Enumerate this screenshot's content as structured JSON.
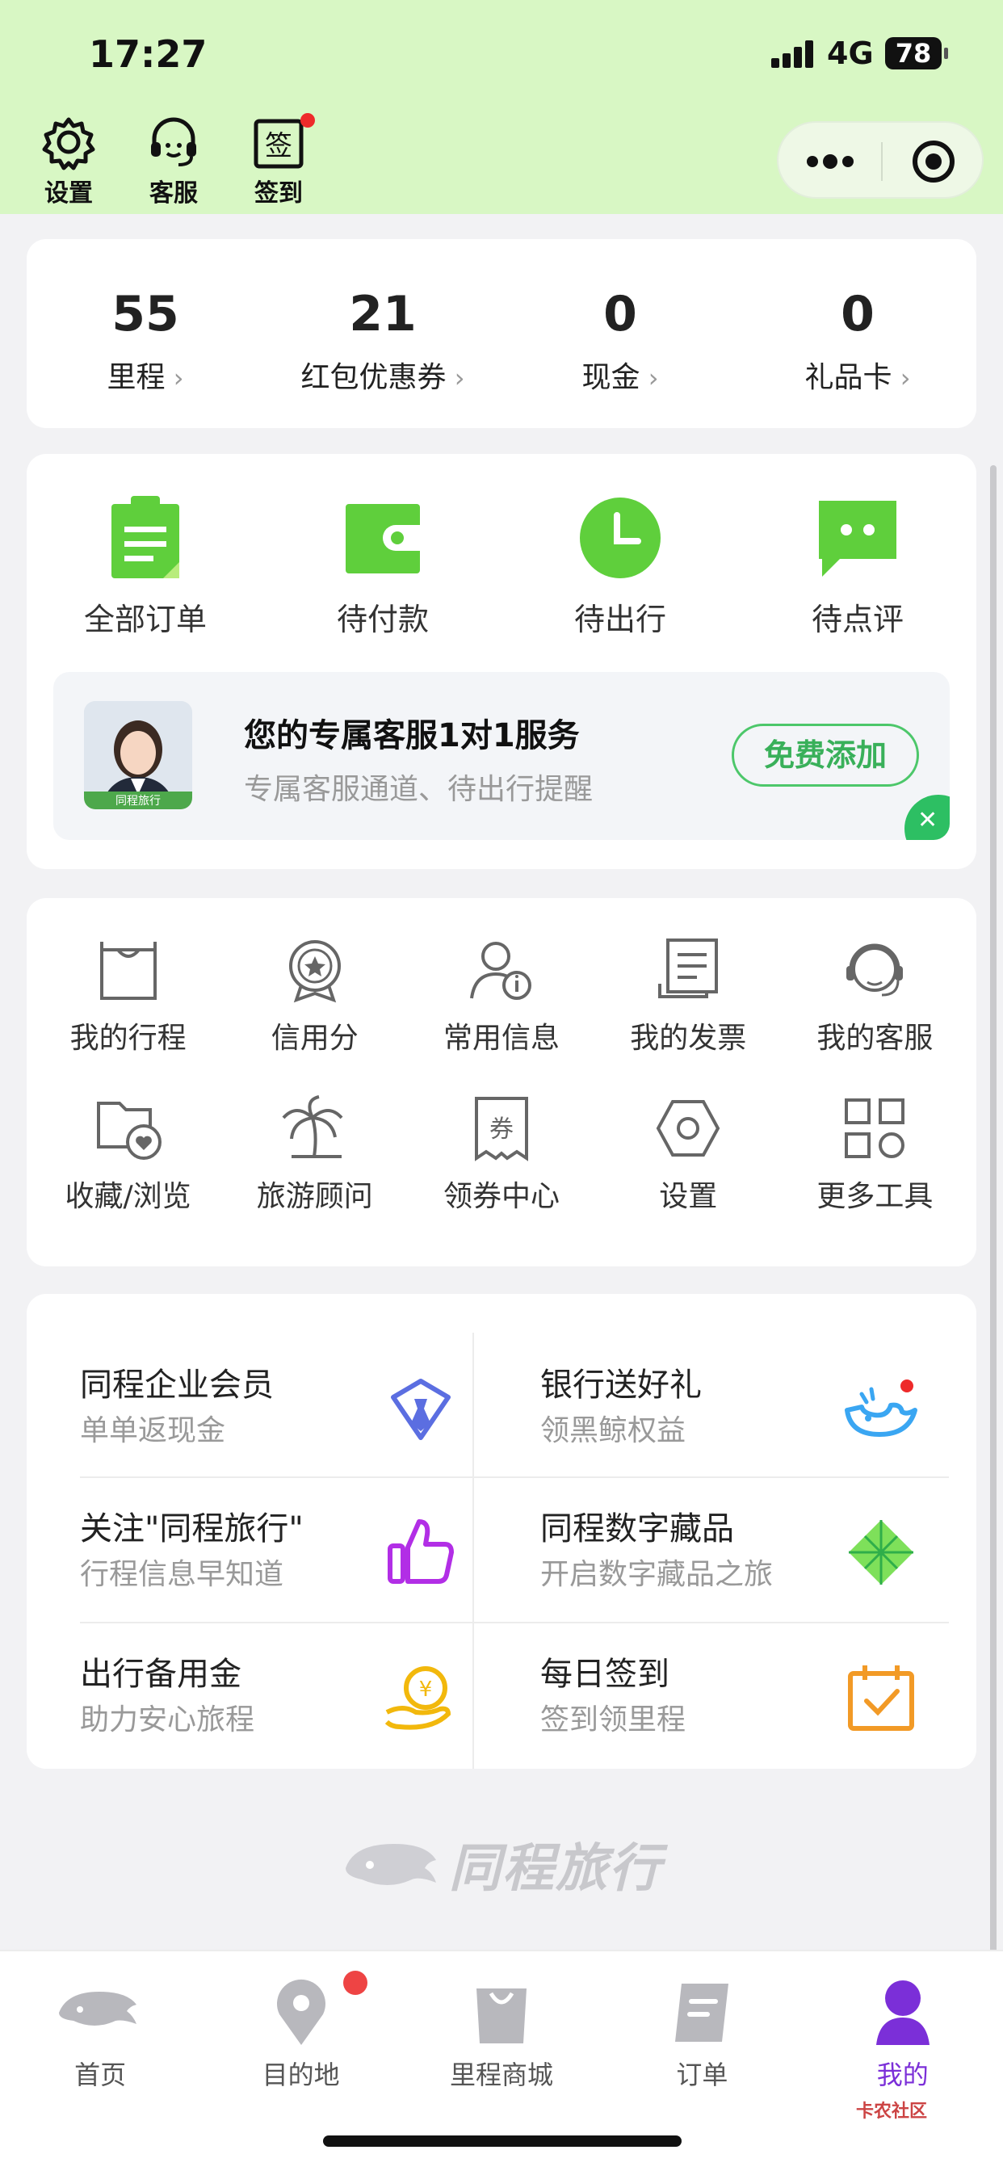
{
  "status": {
    "time": "17:27",
    "network": "4G",
    "battery": "78"
  },
  "top_tools": [
    {
      "label": "设置",
      "icon": "gear-icon"
    },
    {
      "label": "客服",
      "icon": "headset-icon"
    },
    {
      "label": "签到",
      "icon": "checkin-icon"
    }
  ],
  "stats": [
    {
      "value": "55",
      "label": "里程"
    },
    {
      "value": "21",
      "label": "红包优惠券"
    },
    {
      "value": "0",
      "label": "现金"
    },
    {
      "value": "0",
      "label": "礼品卡"
    }
  ],
  "orders": [
    {
      "label": "全部订单",
      "icon": "clipboard-icon"
    },
    {
      "label": "待付款",
      "icon": "wallet-icon"
    },
    {
      "label": "待出行",
      "icon": "clock-icon"
    },
    {
      "label": "待点评",
      "icon": "chat-icon"
    }
  ],
  "service": {
    "title": "您的专属客服1对1服务",
    "subtitle": "专属客服通道、待出行提醒",
    "button": "免费添加",
    "avatar_badge": "同程旅行"
  },
  "tools": [
    {
      "label": "我的行程",
      "icon": "bag-icon"
    },
    {
      "label": "信用分",
      "icon": "medal-icon"
    },
    {
      "label": "常用信息",
      "icon": "user-info-icon"
    },
    {
      "label": "我的发票",
      "icon": "invoice-icon"
    },
    {
      "label": "我的客服",
      "icon": "service-agent-icon"
    },
    {
      "label": "收藏/浏览",
      "icon": "folder-heart-icon"
    },
    {
      "label": "旅游顾问",
      "icon": "palm-tree-icon"
    },
    {
      "label": "领券中心",
      "icon": "coupon-icon"
    },
    {
      "label": "设置",
      "icon": "hexagon-settings-icon"
    },
    {
      "label": "更多工具",
      "icon": "grid-icon"
    }
  ],
  "promos": [
    {
      "title": "同程企业会员",
      "subtitle": "单单返现金",
      "icon": "tie-icon"
    },
    {
      "title": "银行送好礼",
      "subtitle": "领黑鲸权益",
      "icon": "whale-icon"
    },
    {
      "title": "关注\"同程旅行\"",
      "subtitle": "行程信息早知道",
      "icon": "thumbs-up-icon"
    },
    {
      "title": "同程数字藏品",
      "subtitle": "开启数字藏品之旅",
      "icon": "diamond-icon"
    },
    {
      "title": "出行备用金",
      "subtitle": "助力安心旅程",
      "icon": "coin-hand-icon"
    },
    {
      "title": "每日签到",
      "subtitle": "签到领里程",
      "icon": "calendar-check-icon"
    }
  ],
  "brand": {
    "name": "同程旅行"
  },
  "tabbar": [
    {
      "label": "首页",
      "icon": "whale-home-icon"
    },
    {
      "label": "目的地",
      "icon": "location-pin-icon"
    },
    {
      "label": "里程商城",
      "icon": "shopping-bag-icon"
    },
    {
      "label": "订单",
      "icon": "order-book-icon"
    },
    {
      "label": "我的",
      "icon": "profile-icon"
    }
  ],
  "watermark": "卡农社区",
  "colors": {
    "accent_green": "#5fcf3c",
    "header_bg": "#d8f7c4",
    "active_tab": "#7b2fd8"
  }
}
